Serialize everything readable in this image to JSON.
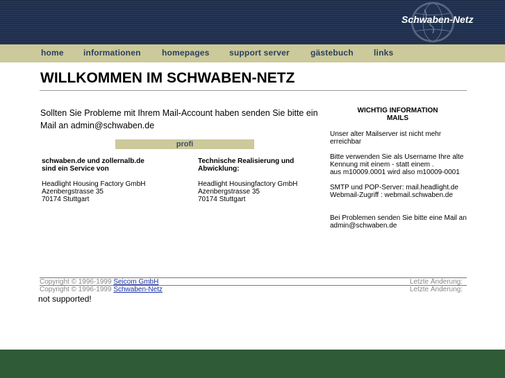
{
  "header": {
    "logo_text": "Schwaben-Netz",
    "colors": {
      "stripe_dark": "#1d2d4a",
      "stripe_light": "#2a3d5e",
      "nav_bg": "#ccc99a",
      "nav_text": "#29405f",
      "footer_green": "#2f5b37"
    }
  },
  "nav": {
    "items": [
      {
        "label": "home"
      },
      {
        "label": "informationen"
      },
      {
        "label": "homepages"
      },
      {
        "label": "support server"
      },
      {
        "label": "gästebuch"
      },
      {
        "label": "links"
      }
    ]
  },
  "main": {
    "title": "WILLKOMMEN IM SCHWABEN-NETZ",
    "intro": "Sollten Sie Probleme mit Ihrem Mail-Account haben senden Sie bitte ein Mail an admin@schwaben.de",
    "profi_label": "profi",
    "col1": {
      "heading_line1": "schwaben.de und zollernalb.de",
      "heading_line2": "sind ein Service von",
      "address_line1": "Headlight Housing Factory GmbH",
      "address_line2": "Azenbergstrasse 35",
      "address_line3": "70174 Stuttgart"
    },
    "col2": {
      "heading_line1": "Technische Realisierung und",
      "heading_line2": "Abwicklung:",
      "address_line1": "Headlight Housingfactory GmbH",
      "address_line2": "Azenbergstrasse 35",
      "address_line3": "70174 Stuttgart"
    }
  },
  "sidebar": {
    "title_line1": "WICHTIG INFORMATION",
    "title_line2": "MAILS",
    "p1_line1": "Unser alter Mailserver ist nicht mehr",
    "p1_line2": "erreichbar",
    "p2_line1": "Bitte verwenden Sie als Username Ihre alte",
    "p2_line2": "Kennung mit einem - statt einem .",
    "p2_line3": "aus m10009.0001 wird also m10009-0001",
    "p3_line1": "SMTP und POP-Server: mail.headlight.de",
    "p3_line2": "Webmail-Zugriff : webmail.schwaben.de",
    "p4_line1": "Bei Problemen senden Sie bitte eine Mail an",
    "p4_line2": "admin@schwaben.de"
  },
  "footer": {
    "row1": {
      "prefix": "Copyright © 1996-1999 ",
      "link": "Seicom GmbH",
      "right": "Letzte Änderung:"
    },
    "row2": {
      "prefix": "Copyright © 1996-1999 ",
      "link": "Schwaben-Netz",
      "right": "Letzte Änderung:"
    },
    "not_supported": "not supported!"
  }
}
